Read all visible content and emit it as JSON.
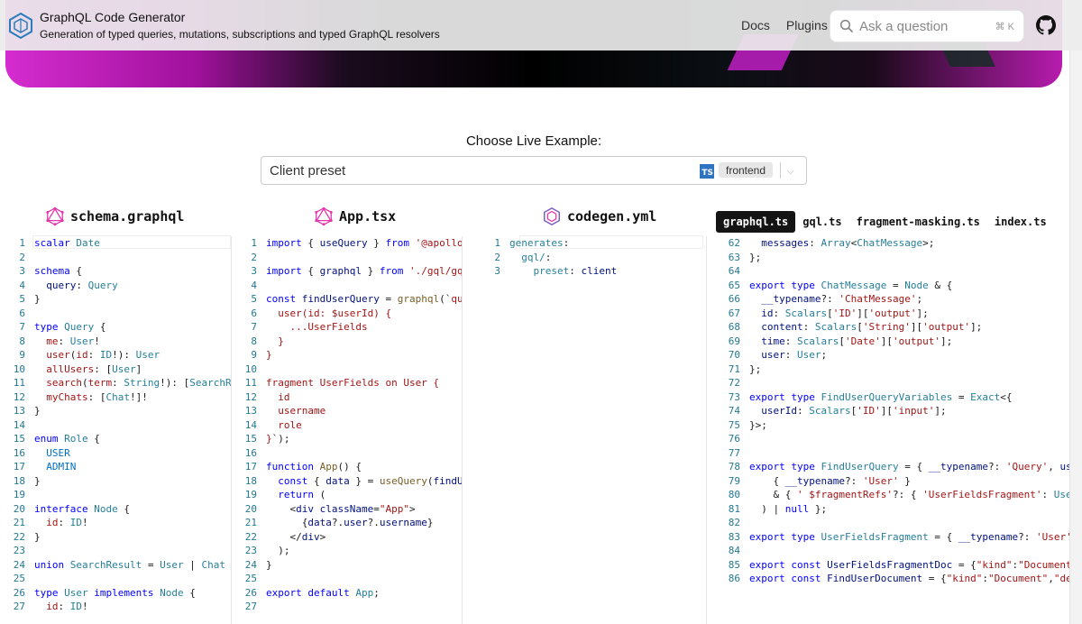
{
  "header": {
    "title": "GraphQL Code Generator",
    "subtitle": "Generation of typed queries, mutations, subscriptions and typed GraphQL resolvers",
    "nav": [
      "Docs",
      "Plugins"
    ],
    "search_placeholder": "Ask a question",
    "search_shortcut": "⌘ K"
  },
  "chooser": {
    "label": "Choose Live Example:",
    "selected": "Client preset",
    "lang_badge": "TS",
    "tag": "frontend"
  },
  "panels": [
    {
      "title": "schema.graphql"
    },
    {
      "title": "App.tsx"
    },
    {
      "title": "codegen.yml"
    }
  ],
  "output_tabs": [
    "graphql.ts",
    "gql.ts",
    "fragment-masking.ts",
    "index.ts"
  ],
  "colors": {
    "accent": "#e535ab",
    "tab_active_bg": "#141414"
  }
}
